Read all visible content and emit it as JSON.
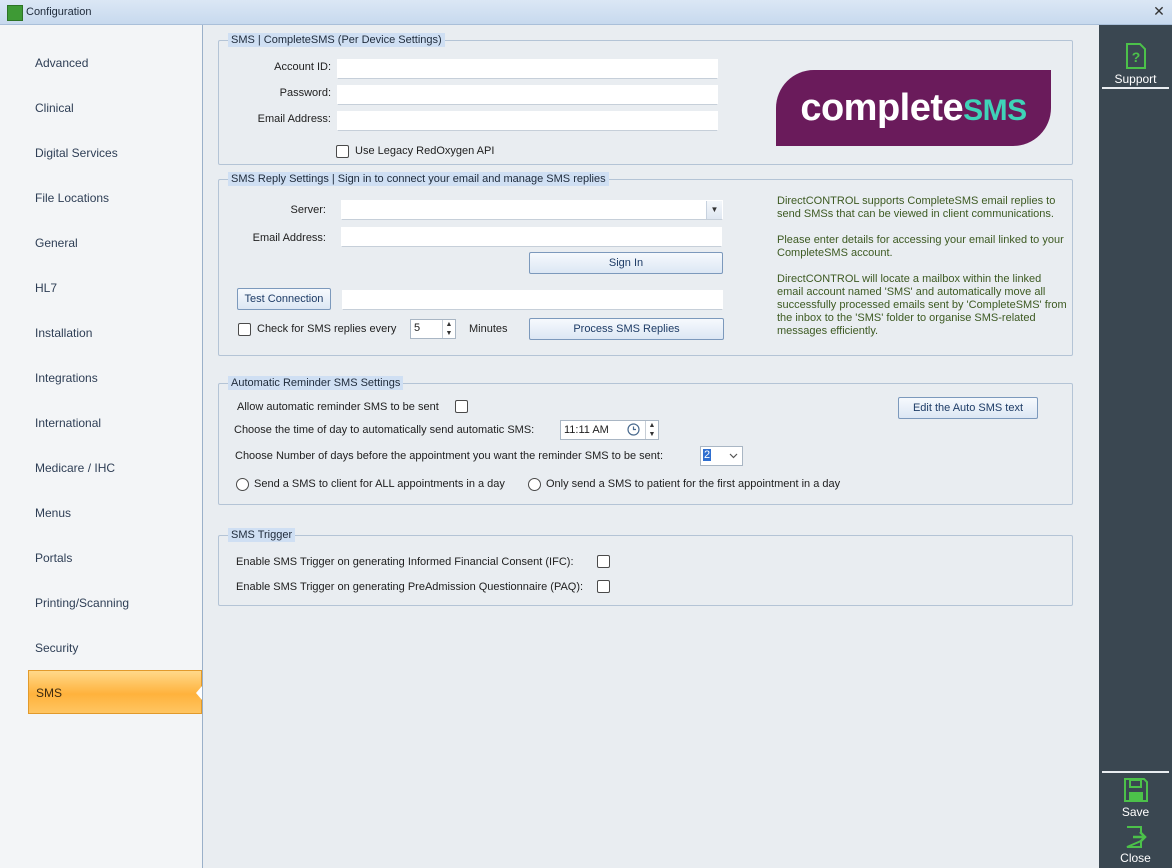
{
  "window": {
    "title": "Configuration",
    "close_glyph": "✕"
  },
  "nav": {
    "items": [
      {
        "label": "Advanced"
      },
      {
        "label": "Clinical"
      },
      {
        "label": "Digital Services"
      },
      {
        "label": "File Locations"
      },
      {
        "label": "General"
      },
      {
        "label": "HL7"
      },
      {
        "label": "Installation"
      },
      {
        "label": "Integrations"
      },
      {
        "label": "International"
      },
      {
        "label": "Medicare / IHC"
      },
      {
        "label": "Menus"
      },
      {
        "label": "Portals"
      },
      {
        "label": "Printing/Scanning"
      },
      {
        "label": "Security"
      },
      {
        "label": "SMS",
        "active": true
      }
    ]
  },
  "sidebar": {
    "support_label": "Support",
    "save_label": "Save",
    "close_label": "Close"
  },
  "sms_device": {
    "legend": "SMS | CompleteSMS (Per Device Settings)",
    "account_id_label": "Account ID:",
    "account_id_value": "",
    "password_label": "Password:",
    "password_value": "",
    "email_label": "Email Address:",
    "email_value": "",
    "legacy_label": "Use Legacy RedOxygen API",
    "legacy_checked": false,
    "logo_text_main": "complete",
    "logo_text_sms": "SMS"
  },
  "reply": {
    "legend": "SMS Reply Settings | Sign in to connect your email and manage SMS replies",
    "server_label": "Server:",
    "server_value": "",
    "email_label": "Email Address:",
    "email_value": "",
    "sign_in_label": "Sign In",
    "test_connection_label": "Test Connection",
    "test_result_value": "",
    "check_label": "Check for SMS replies every",
    "check_minutes": "5",
    "minutes_label": "Minutes",
    "process_label": "Process SMS Replies",
    "help": [
      "DirectCONTROL supports CompleteSMS email replies to send SMSs that can be viewed in client communications.",
      "Please enter details for accessing your email linked to your CompleteSMS account.",
      "DirectCONTROL will locate a mailbox within the linked email account named 'SMS' and automatically move all successfully processed emails sent by 'CompleteSMS' from the inbox to the 'SMS' folder to organise SMS-related messages efficiently."
    ]
  },
  "auto": {
    "legend": "Automatic Reminder SMS Settings",
    "allow_label": "Allow automatic reminder SMS to be sent",
    "edit_label": "Edit the Auto SMS text",
    "time_label": "Choose the time of day to automatically send automatic SMS:",
    "time_value": "11:11 AM",
    "days_label": "Choose Number of days before the appointment you want the reminder SMS to be sent:",
    "days_value": "2",
    "radio_all_label": "Send a SMS to client for ALL appointments in a day",
    "radio_first_label": "Only send a SMS to patient for the first appointment in a day"
  },
  "trigger": {
    "legend": "SMS Trigger",
    "ifc_label": "Enable SMS Trigger on generating Informed Financial Consent (IFC):",
    "paq_label": "Enable SMS Trigger on generating PreAdmission Questionnaire (PAQ):"
  },
  "colors": {
    "accent_orange": "#ffb23c",
    "sidebar_dark": "#3a4751",
    "icon_green": "#4cc14a",
    "logo_purple": "#6a1b5b",
    "logo_teal": "#3fd3b8",
    "help_text": "#3d5a22"
  },
  "icons": {
    "support": "question-document-icon",
    "save": "floppy-disk-icon",
    "close": "exit-arrow-icon",
    "time_picker": "clock-icon",
    "dropdown": "chevron-down-icon"
  }
}
